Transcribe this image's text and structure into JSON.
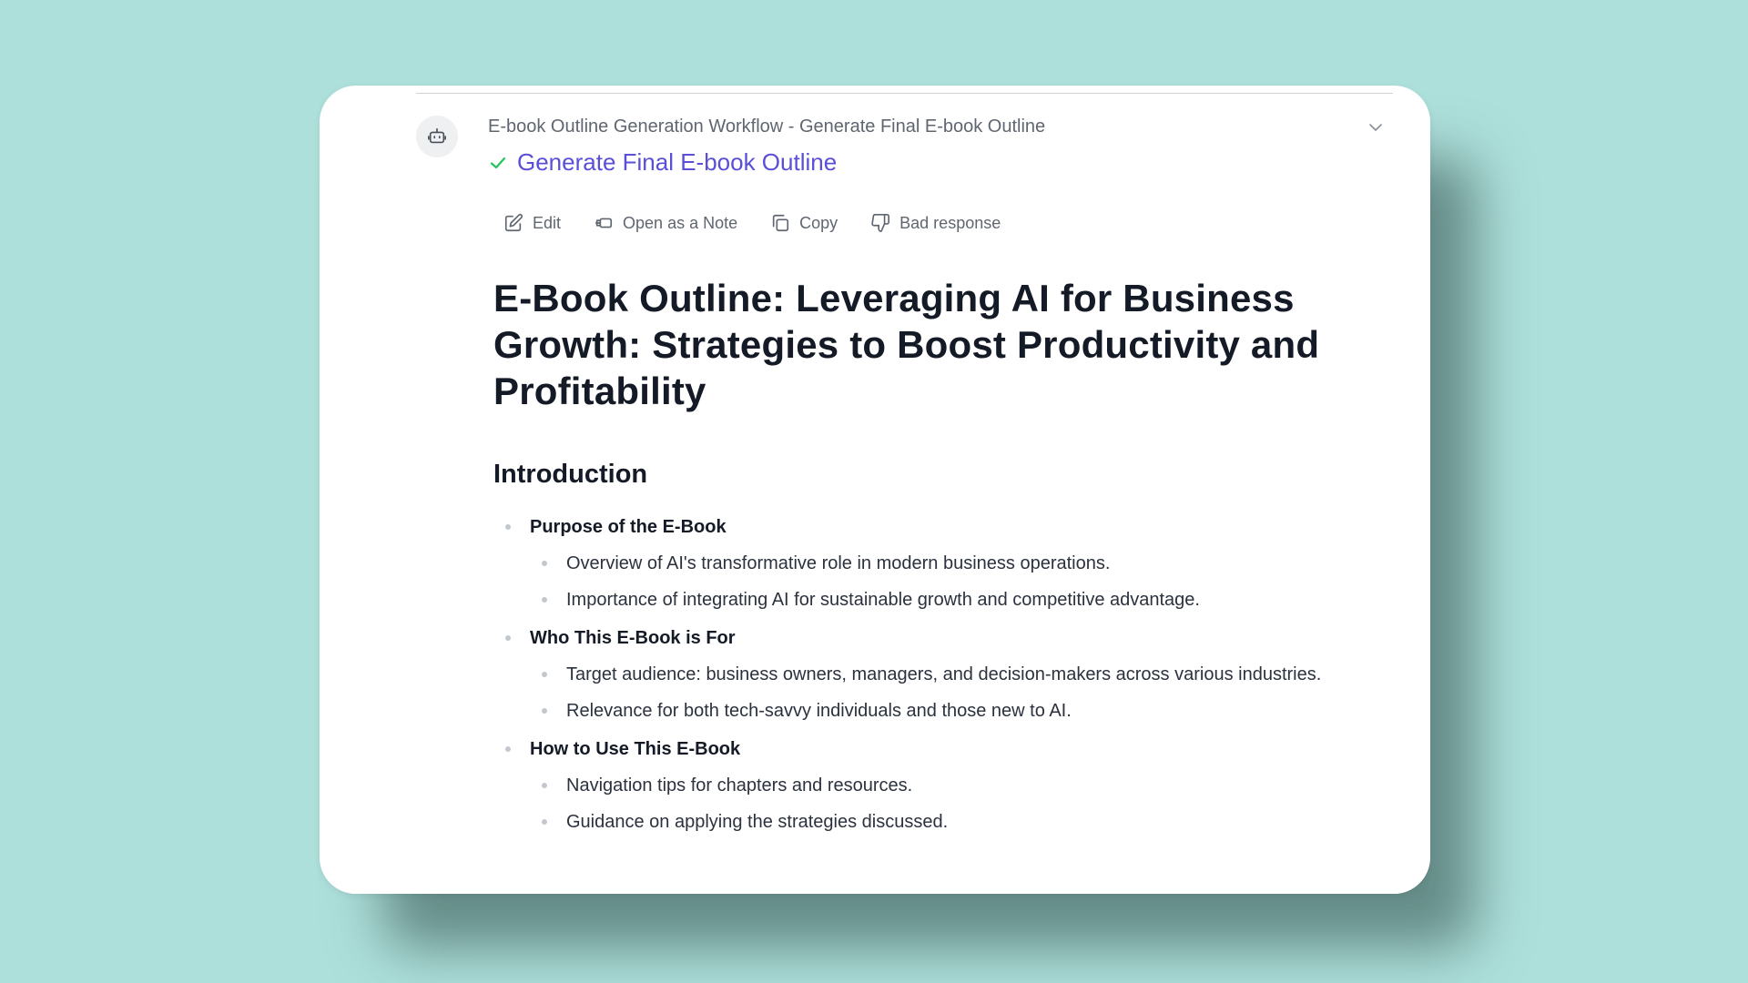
{
  "header": {
    "workflow_title": "E-book Outline Generation Workflow - Generate Final E-book Outline",
    "step_label": "Generate Final E-book Outline",
    "step_status_color": "#22c55e",
    "accent_color": "#5a4fd6"
  },
  "toolbar": {
    "edit_label": "Edit",
    "open_note_label": "Open as a Note",
    "copy_label": "Copy",
    "bad_response_label": "Bad response"
  },
  "document": {
    "title": "E-Book Outline: Leveraging AI for Business Growth: Strategies to Boost Productivity and Profitability",
    "section": {
      "heading": "Introduction",
      "items": [
        {
          "label": "Purpose of the E-Book",
          "subitems": [
            "Overview of AI's transformative role in modern business operations.",
            "Importance of integrating AI for sustainable growth and competitive advantage."
          ]
        },
        {
          "label": "Who This E-Book is For",
          "subitems": [
            "Target audience: business owners, managers, and decision-makers across various industries.",
            "Relevance for both tech-savvy individuals and those new to AI."
          ]
        },
        {
          "label": "How to Use This E-Book",
          "subitems": [
            "Navigation tips for chapters and resources.",
            "Guidance on applying the strategies discussed."
          ]
        }
      ]
    }
  }
}
